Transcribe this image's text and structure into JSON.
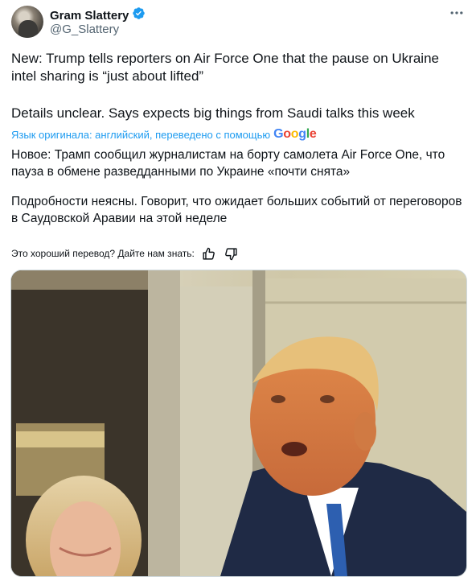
{
  "tweet": {
    "author": {
      "display_name": "Gram Slattery",
      "handle": "@G_Slattery",
      "avatar_icon": "avatar-photo",
      "verified_icon": "verified-badge-icon",
      "verified_color": "#1d9bf0"
    },
    "more_icon": "more-options-icon",
    "text_p1": "New: Trump tells reporters on Air Force One that the pause on Ukraine intel sharing is “just about lifted”",
    "text_p2": "Details unclear. Says expects big things from Saudi talks this week",
    "translation": {
      "label": "Язык оригинала: английский, переведено с помощью",
      "provider": "Google",
      "p1": "Новое: Трамп сообщил журналистам на борту самолета Air Force One, что пауза в обмене разведданными по Украине «почти снята»",
      "p2": "Подробности неясны. Говорит, что ожидает больших событий от переговоров в Саудовской Аравии на этой неделе",
      "feedback_prompt": "Это хороший перевод? Дайте нам знать:",
      "thumbs_up_icon": "thumbs-up-icon",
      "thumbs_down_icon": "thumbs-down-icon"
    },
    "media": {
      "type": "photo",
      "alt_icon": "press-photo-aircraft-cabin"
    }
  },
  "colors": {
    "accent": "#1d9bf0",
    "text": "#0f1419",
    "secondary": "#536471"
  }
}
